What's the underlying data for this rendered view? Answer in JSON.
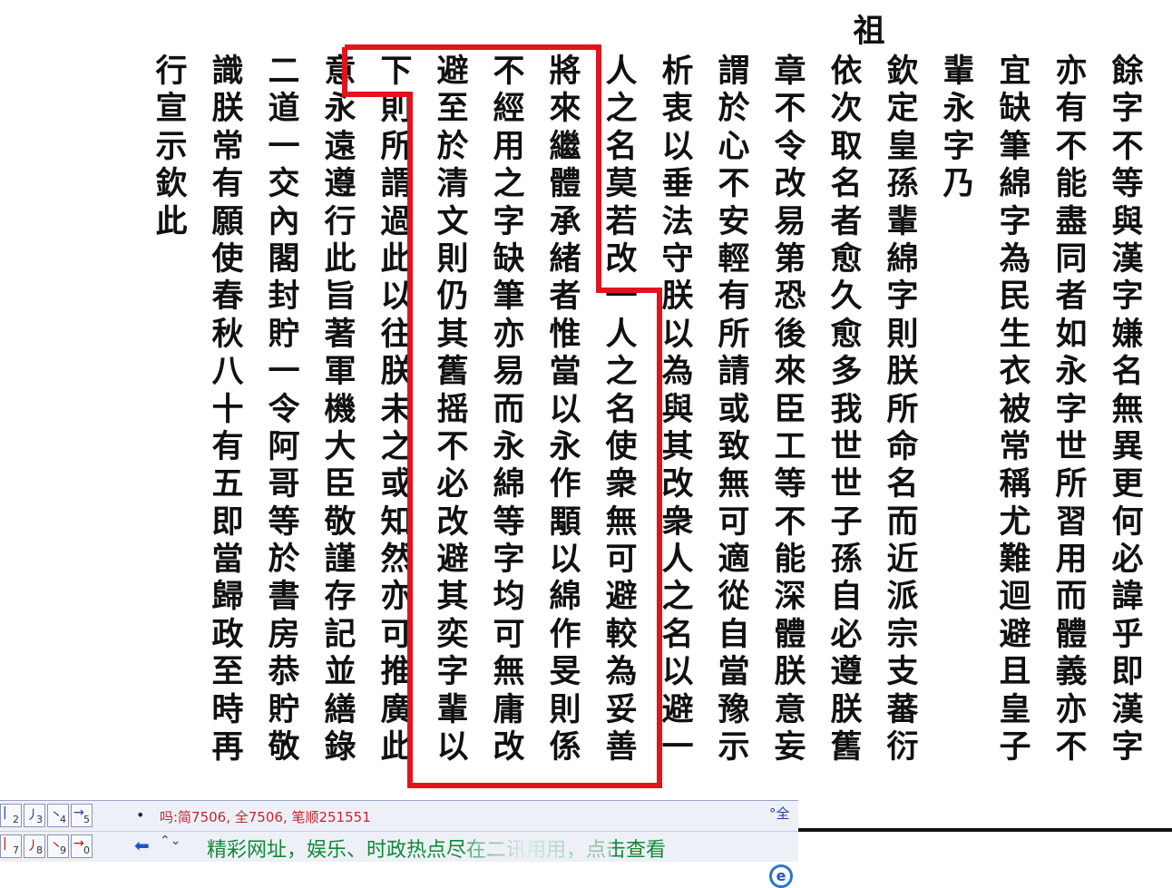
{
  "document": {
    "top_fragment": "祖",
    "columns": [
      "餘字不等與漢字嫌名無異更何必諱乎即漢字",
      "亦有不能盡同者如永字世所習用而體義亦不",
      "宜缺筆綿字為民生衣被常稱尤難迴避且皇子",
      "輩永字乃",
      "欽定皇孫輩綿字則朕所命名而近派宗支蕃衍",
      "依次取名者愈久愈多我世世子孫自必遵朕舊",
      "章不令改易第恐後來臣工等不能深體朕意妄",
      "謂於心不安輕有所請或致無可適從自當豫示",
      "析衷以垂法守朕以為與其改衆人之名以避一",
      "人之名莫若改一人之名使衆無可避較為妥善",
      "將來繼體承緒者惟當以永作顒以綿作旻則係",
      "不經用之字缺筆亦易而永綿等字均可無庸改",
      "避至於清文則仍其舊摇不必改避其奕字輩以",
      "下則所謂過此以往朕未之或知然亦可推廣此",
      "意永遠遵行此旨著軍機大臣敬謹存記並繕錄",
      "二道一交內閣封貯一令阿哥等於書房恭貯敬",
      "識朕常有願使春秋八十有五即當歸政至時再",
      "行宣示欽此"
    ]
  },
  "ime_bar": {
    "stroke_keys": [
      {
        "num": "2",
        "glyph": "|"
      },
      {
        "num": "3",
        "glyph": "丿"
      },
      {
        "num": "4",
        "glyph": "丶"
      },
      {
        "num": "5",
        "glyph": "→"
      },
      {
        "num": "7",
        "glyph": "|"
      },
      {
        "num": "8",
        "glyph": "丿"
      },
      {
        "num": "9",
        "glyph": "丶"
      },
      {
        "num": "0",
        "glyph": "→"
      }
    ],
    "status_text": "吗:简7506, 全7506, 笔顺251551",
    "dot": "•",
    "back_arrow": "⬅",
    "updown": "⌃⌄",
    "ad_text": "精彩网址，娱乐、时政热点尽在二讯用用，点击查看",
    "full_mark": "°全",
    "ie_glyph": "e"
  },
  "colors": {
    "highlight": "#e0141e",
    "ime_bg": "#eef0f7",
    "status_text": "#c0282d",
    "ad_text": "#0e8a36"
  }
}
